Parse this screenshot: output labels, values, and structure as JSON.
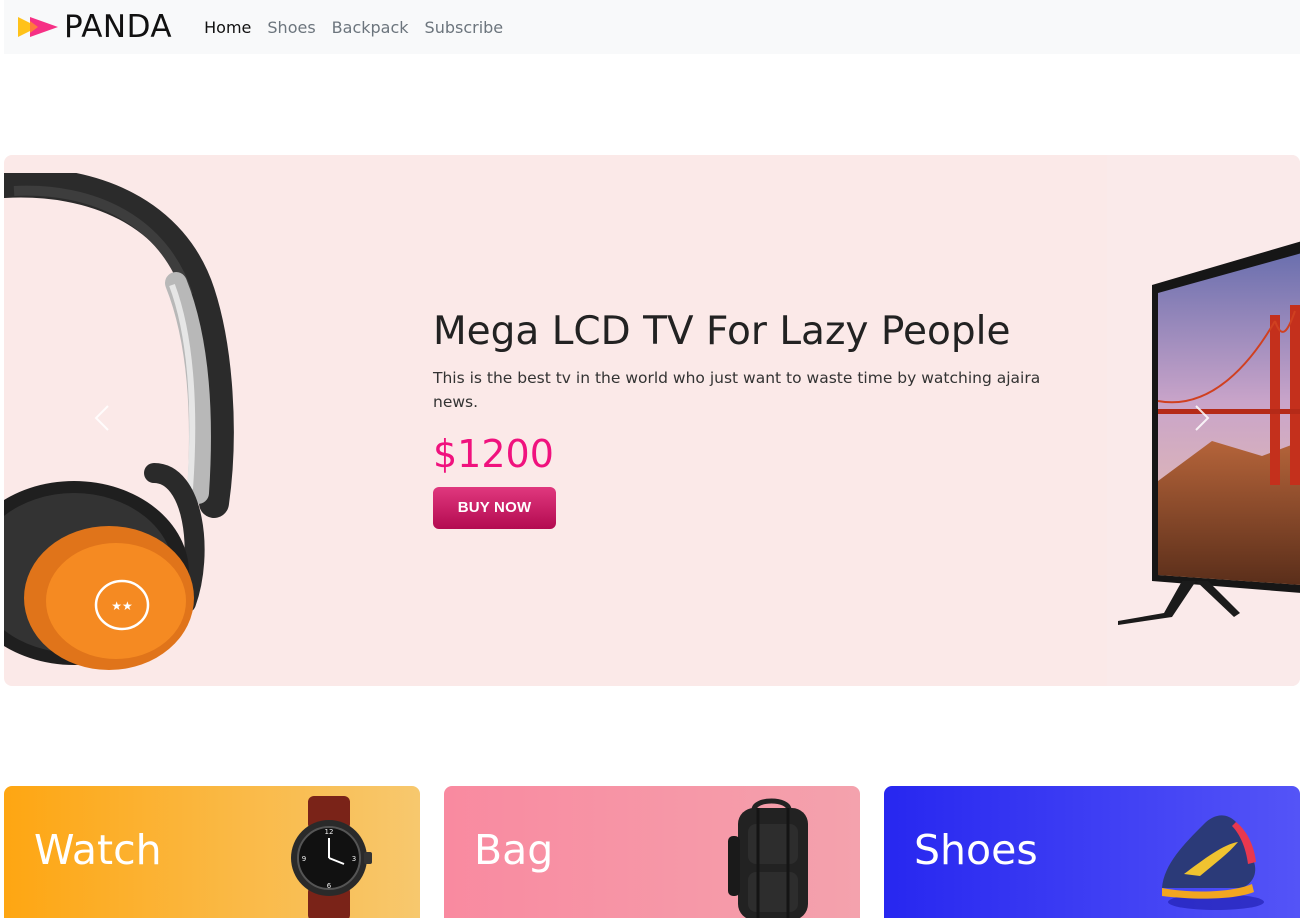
{
  "navbar": {
    "brand": "PANDA",
    "links": [
      {
        "label": "Home",
        "active": true
      },
      {
        "label": "Shoes",
        "active": false
      },
      {
        "label": "Backpack",
        "active": false
      },
      {
        "label": "Subscribe",
        "active": false
      }
    ]
  },
  "carousel": {
    "title": "Mega LCD TV For Lazy People",
    "description": "This is the best tv in the world who just want to waste time by watching ajaira news.",
    "price": "$1200",
    "button_label": "BUY NOW",
    "prev_icon": "chevron-left-icon",
    "next_icon": "chevron-right-icon"
  },
  "categories": [
    {
      "label": "Watch",
      "image": "watch"
    },
    {
      "label": "Bag",
      "image": "backpack"
    },
    {
      "label": "Shoes",
      "image": "sneaker"
    }
  ],
  "colors": {
    "price": "#f0127e",
    "button": "#c9195f",
    "carousel_bg": "#fbe9e8",
    "watch_card": "#fea612",
    "bag_card": "#f98aa0",
    "shoes_card": "#2727f0"
  }
}
